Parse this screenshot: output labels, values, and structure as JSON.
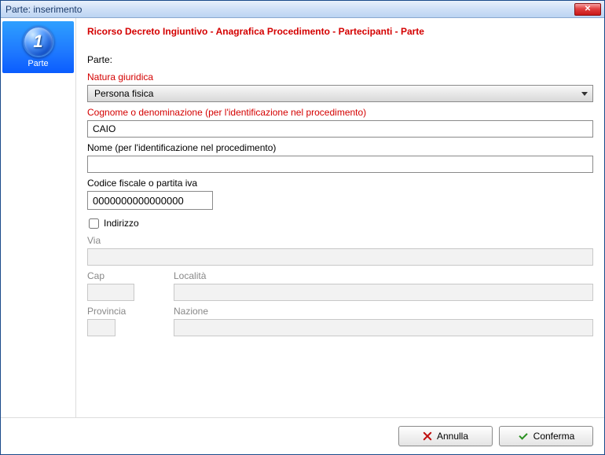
{
  "window": {
    "title": "Parte: inserimento"
  },
  "sidebar": {
    "step_number": "1",
    "step_label": "Parte"
  },
  "breadcrumb": "Ricorso Decreto Ingiuntivo - Anagrafica Procedimento - Partecipanti - Parte",
  "form": {
    "section_title": "Parte:",
    "natura_label": "Natura giuridica",
    "natura_value": "Persona fisica",
    "cognome_label": "Cognome o denominazione (per l'identificazione nel procedimento)",
    "cognome_value": "CAIO",
    "nome_label": "Nome (per l'identificazione nel procedimento)",
    "nome_value": "",
    "cf_label": "Codice fiscale o partita iva",
    "cf_value": "0000000000000000",
    "indirizzo_checkbox_label": "Indirizzo",
    "indirizzo_checked": false,
    "via_label": "Via",
    "via_value": "",
    "cap_label": "Cap",
    "cap_value": "",
    "localita_label": "Località",
    "localita_value": "",
    "provincia_label": "Provincia",
    "provincia_value": "",
    "nazione_label": "Nazione",
    "nazione_value": ""
  },
  "footer": {
    "annulla_label": "Annulla",
    "conferma_label": "Conferma"
  }
}
